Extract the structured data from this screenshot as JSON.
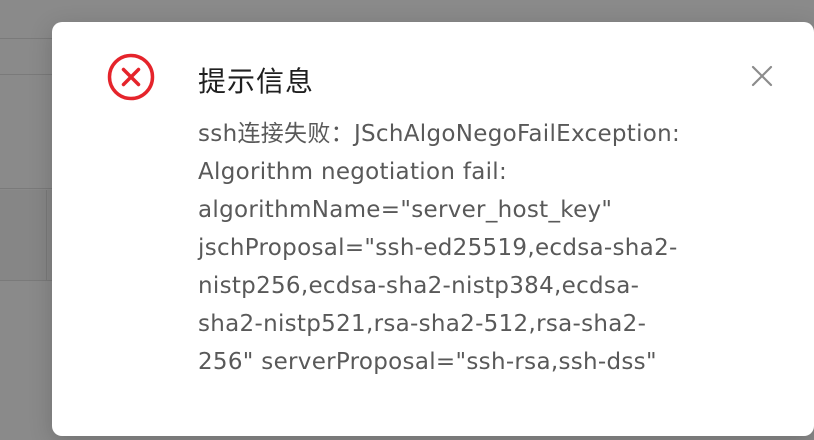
{
  "dialog": {
    "icon": "error-circle-icon",
    "icon_color": "#e5242b",
    "title": "提示信息",
    "close_icon": "close-icon",
    "message_lines": [
      "ssh连接失败：JSchAlgoNegoFailException:",
      "Algorithm negotiation fail:",
      "algorithmName=\"server_host_key\"",
      "jschProposal=\"ssh-ed25519,ecdsa-sha2-",
      "nistp256,ecdsa-sha2-nistp384,ecdsa-",
      "sha2-nistp521,rsa-sha2-512,rsa-sha2-",
      "256\" serverProposal=\"ssh-rsa,ssh-dss\""
    ]
  }
}
